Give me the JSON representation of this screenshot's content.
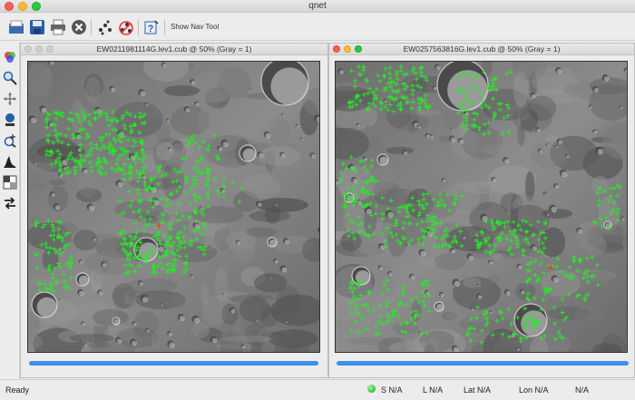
{
  "app": {
    "title": "qnet"
  },
  "toolbar": {
    "show_nav_tool_label": "Show Nav Tool",
    "buttons": [
      "open-file-icon",
      "save-network-icon",
      "print-icon",
      "close-icon",
      "find-points-icon",
      "delete-points-icon",
      "help-icon"
    ]
  },
  "tools": [
    "color-channels-icon",
    "zoom-icon",
    "pan-icon",
    "stretch-icon",
    "find-icon",
    "histogram-icon",
    "blink-icon",
    "swap-icon"
  ],
  "viewers": [
    {
      "title": "EW0211981114G.lev1.cub @ 50% (Gray = 1)"
    },
    {
      "title": "EW0257563816G.lev1.cub @ 50% (Gray = 1)"
    }
  ],
  "status": {
    "ready": "Ready",
    "sample": "S N/A",
    "line": "L N/A",
    "lat": "Lat N/A",
    "lon": "Lon N/A",
    "value": "N/A"
  },
  "colors": {
    "point_marker": "#22ee22",
    "selected_marker": "#e33",
    "scrollbar": "#3d8fe8"
  }
}
